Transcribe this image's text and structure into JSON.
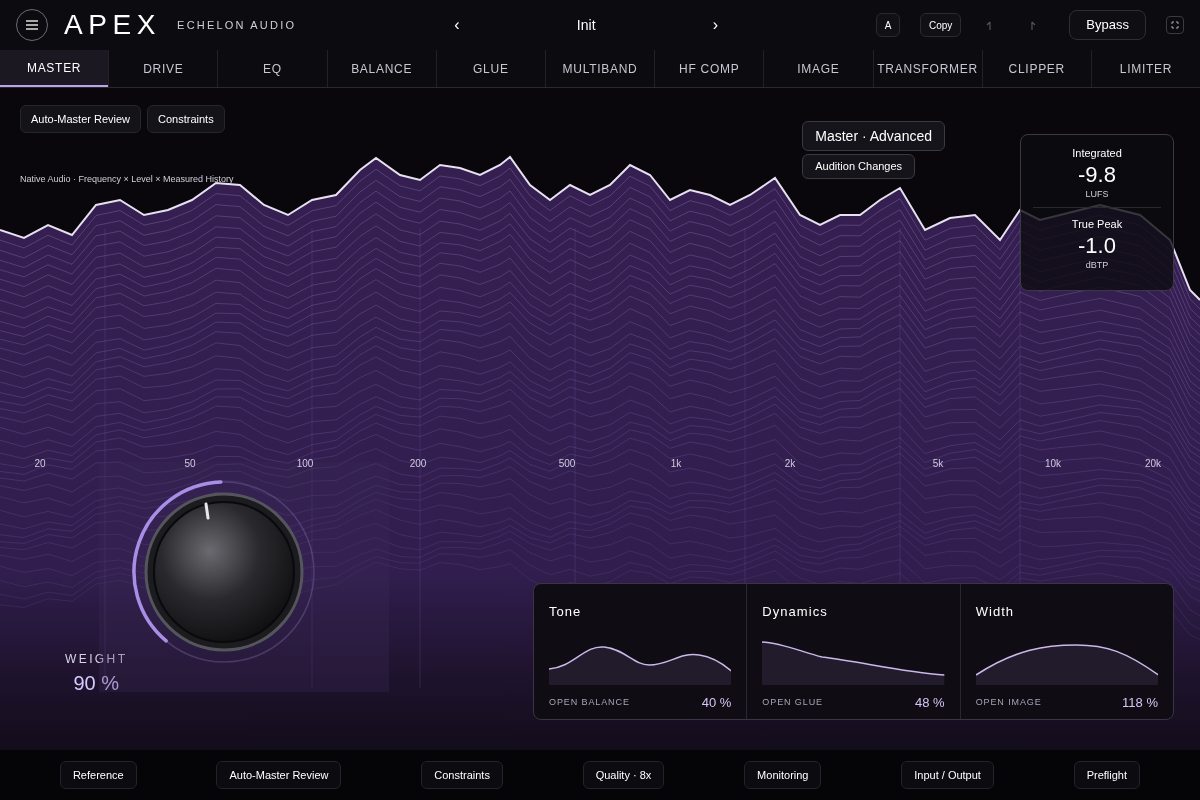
{
  "header": {
    "logo": "APEX",
    "brand": "ECHELON AUDIO",
    "preset": {
      "prev": "‹",
      "name": "Init",
      "next": "›"
    },
    "ab": "A",
    "copy": "Copy",
    "bypass": "Bypass"
  },
  "tabs": [
    {
      "label": "MASTER",
      "selected": true
    },
    {
      "label": "DRIVE",
      "selected": false
    },
    {
      "label": "EQ",
      "selected": false
    },
    {
      "label": "BALANCE",
      "selected": false
    },
    {
      "label": "GLUE",
      "selected": false
    },
    {
      "label": "MULTIBAND",
      "selected": false
    },
    {
      "label": "HF COMP",
      "selected": false
    },
    {
      "label": "IMAGE",
      "selected": false
    },
    {
      "label": "TRANSFORMER",
      "selected": false
    },
    {
      "label": "CLIPPER",
      "selected": false
    },
    {
      "label": "LIMITER",
      "selected": false
    }
  ],
  "toolbar": [
    "Auto-Master Review",
    "Constraints"
  ],
  "spectrum": {
    "caption": "Native Audio · Frequency × Level × Measured History",
    "freq_labels": [
      "20",
      "50",
      "100",
      "200",
      "500",
      "1k",
      "2k",
      "5k",
      "10k",
      "20k"
    ]
  },
  "mode": {
    "title": "Master · Advanced",
    "audition": "Audition Changes"
  },
  "meters": [
    {
      "label": "Integrated",
      "value": "-9.8",
      "unit": "LUFS"
    },
    {
      "label": "True Peak",
      "value": "-1.0",
      "unit": "dBTP"
    }
  ],
  "weight": {
    "label": "WEIGHT",
    "value": "90 %"
  },
  "macros": [
    {
      "title": "Tone",
      "link": "OPEN BALANCE",
      "value": "40 %",
      "kind": "tone"
    },
    {
      "title": "Dynamics",
      "link": "OPEN GLUE",
      "value": "48 %",
      "kind": "dynamics"
    },
    {
      "title": "Width",
      "link": "OPEN IMAGE",
      "value": "118 %",
      "kind": "width"
    }
  ],
  "footer": [
    "Reference",
    "Auto-Master Review",
    "Constraints",
    "Quality · 8x",
    "Monitoring",
    "Input / Output",
    "Preflight"
  ]
}
